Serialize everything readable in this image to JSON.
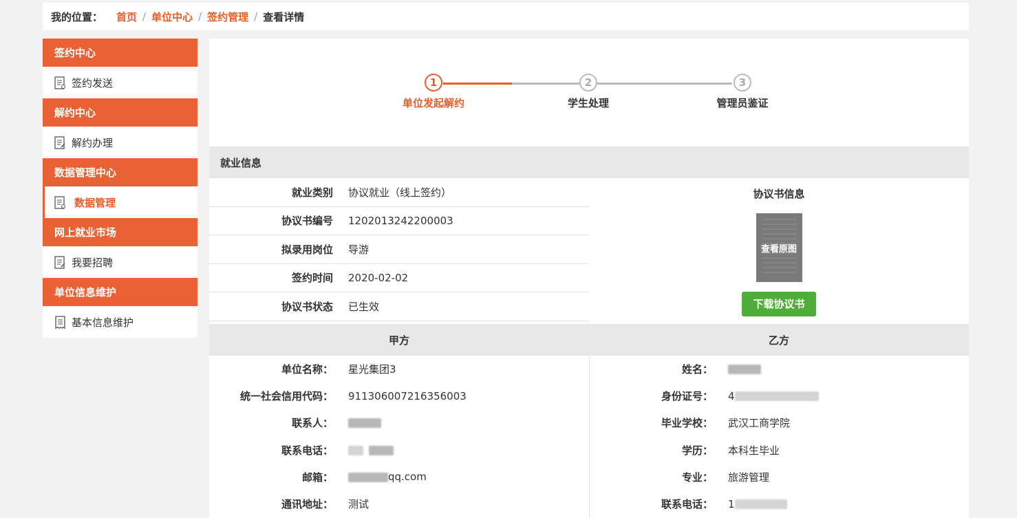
{
  "breadcrumb": {
    "label": "我的位置：",
    "links": [
      "首页",
      "单位中心",
      "签约管理"
    ],
    "current": "查看详情"
  },
  "sidebar": {
    "sections": [
      {
        "header": "签约中心",
        "item": "签约发送",
        "active": false
      },
      {
        "header": "解约中心",
        "item": "解约办理",
        "active": false
      },
      {
        "header": "数据管理中心",
        "item": "数据管理",
        "active": true
      },
      {
        "header": "网上就业市场",
        "item": "我要招聘",
        "active": false
      },
      {
        "header": "单位信息维护",
        "item": "基本信息维护",
        "active": false
      }
    ]
  },
  "steps": [
    {
      "num": "1",
      "label": "单位发起解约",
      "done": true
    },
    {
      "num": "2",
      "label": "学生处理",
      "done": false
    },
    {
      "num": "3",
      "label": "管理员鉴证",
      "done": false
    }
  ],
  "employment": {
    "section_title": "就业信息",
    "rows": [
      {
        "key": "就业类别",
        "value": "协议就业（线上签约）"
      },
      {
        "key": "协议书编号",
        "value": "1202013242200003"
      },
      {
        "key": "拟录用岗位",
        "value": "导游"
      },
      {
        "key": "签约时间",
        "value": "2020-02-02"
      },
      {
        "key": "协议书状态",
        "value": "已生效"
      }
    ]
  },
  "contract": {
    "title": "协议书信息",
    "thumb_label": "查看原图",
    "download_label": "下载协议书"
  },
  "party_a": {
    "title": "甲方",
    "rows": [
      {
        "key": "单位名称：",
        "value": "星光集团3"
      },
      {
        "key": "统一社会信用代码：",
        "value": "911306007216356003"
      },
      {
        "key": "联系人：",
        "value": ""
      },
      {
        "key": "联系电话：",
        "value": ""
      },
      {
        "key": "邮箱：",
        "value": "qq.com"
      },
      {
        "key": "通讯地址：",
        "value": "测试"
      }
    ]
  },
  "party_b": {
    "title": "乙方",
    "rows": [
      {
        "key": "姓名：",
        "value": ""
      },
      {
        "key": "身份证号：",
        "value": "4"
      },
      {
        "key": "毕业学校：",
        "value": "武汉工商学院"
      },
      {
        "key": "学历：",
        "value": "本科生毕业"
      },
      {
        "key": "专业：",
        "value": "旅游管理"
      },
      {
        "key": "联系电话：",
        "value": "1"
      }
    ]
  },
  "colors": {
    "accent": "#ea6233",
    "success": "#4fae3a"
  }
}
